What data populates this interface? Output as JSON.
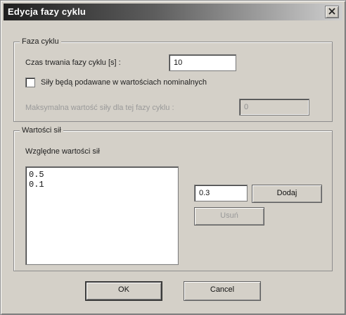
{
  "window": {
    "title": "Edycja fazy cyklu"
  },
  "phase_group": {
    "legend": "Faza cyklu",
    "duration_label": "Czas trwania fazy cyklu [s] :",
    "duration_value": "10",
    "checkbox_label": "Siły będą podawane w wartościach nominalnych",
    "checkbox_checked": false,
    "max_force_label": "Maksymalna wartość siły dla tej fazy cyklu :",
    "max_force_value": "0"
  },
  "forces_group": {
    "legend": "Wartości sił",
    "list_label": "Względne wartości sił",
    "items": [
      "0.5",
      "0.1"
    ],
    "new_value": "0.3",
    "add_button": "Dodaj",
    "remove_button": "Usuń"
  },
  "footer": {
    "ok_button": "OK",
    "cancel_button": "Cancel"
  }
}
